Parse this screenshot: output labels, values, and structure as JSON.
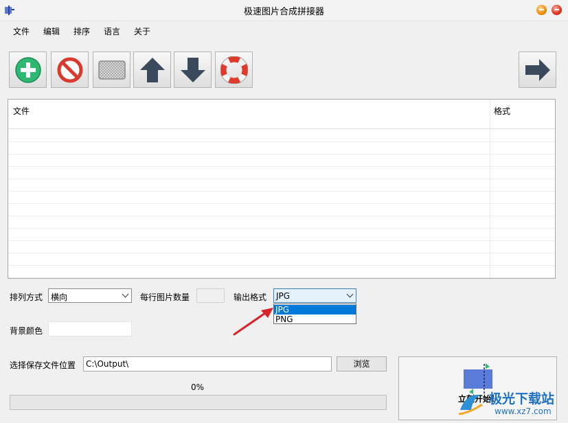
{
  "window": {
    "title": "极速图片合成拼接器"
  },
  "menu": {
    "items": [
      "文件",
      "编辑",
      "排序",
      "语言",
      "关于"
    ]
  },
  "toolbar": {
    "buttons": [
      {
        "icon": "add-icon"
      },
      {
        "icon": "remove-icon"
      },
      {
        "icon": "clear-icon"
      },
      {
        "icon": "move-up-icon"
      },
      {
        "icon": "move-down-icon"
      },
      {
        "icon": "help-icon"
      },
      {
        "icon": "next-arrow-icon"
      }
    ]
  },
  "file_list": {
    "columns": [
      "文件",
      "格式"
    ],
    "rows": []
  },
  "options": {
    "arrange_label": "排列方式",
    "arrange_value": "横向",
    "per_row_label": "每行图片数量",
    "per_row_value": "",
    "format_label": "输出格式",
    "format_value": "JPG",
    "format_options": [
      "JPG",
      "PNG"
    ],
    "bg_color_label": "背景颜色"
  },
  "output": {
    "save_label": "选择保存文件位置",
    "save_path": "C:\\Output\\",
    "browse_label": "浏览"
  },
  "progress": {
    "text": "0%",
    "value": 0
  },
  "start_button": {
    "label": "立刻开始!"
  },
  "watermark": {
    "text": "极光下载站",
    "url": "www.xz7.com"
  },
  "colors": {
    "accent": "#0078d7",
    "arrow": "#d9232a",
    "add": "#2eb872",
    "stop": "#d83b2d"
  }
}
